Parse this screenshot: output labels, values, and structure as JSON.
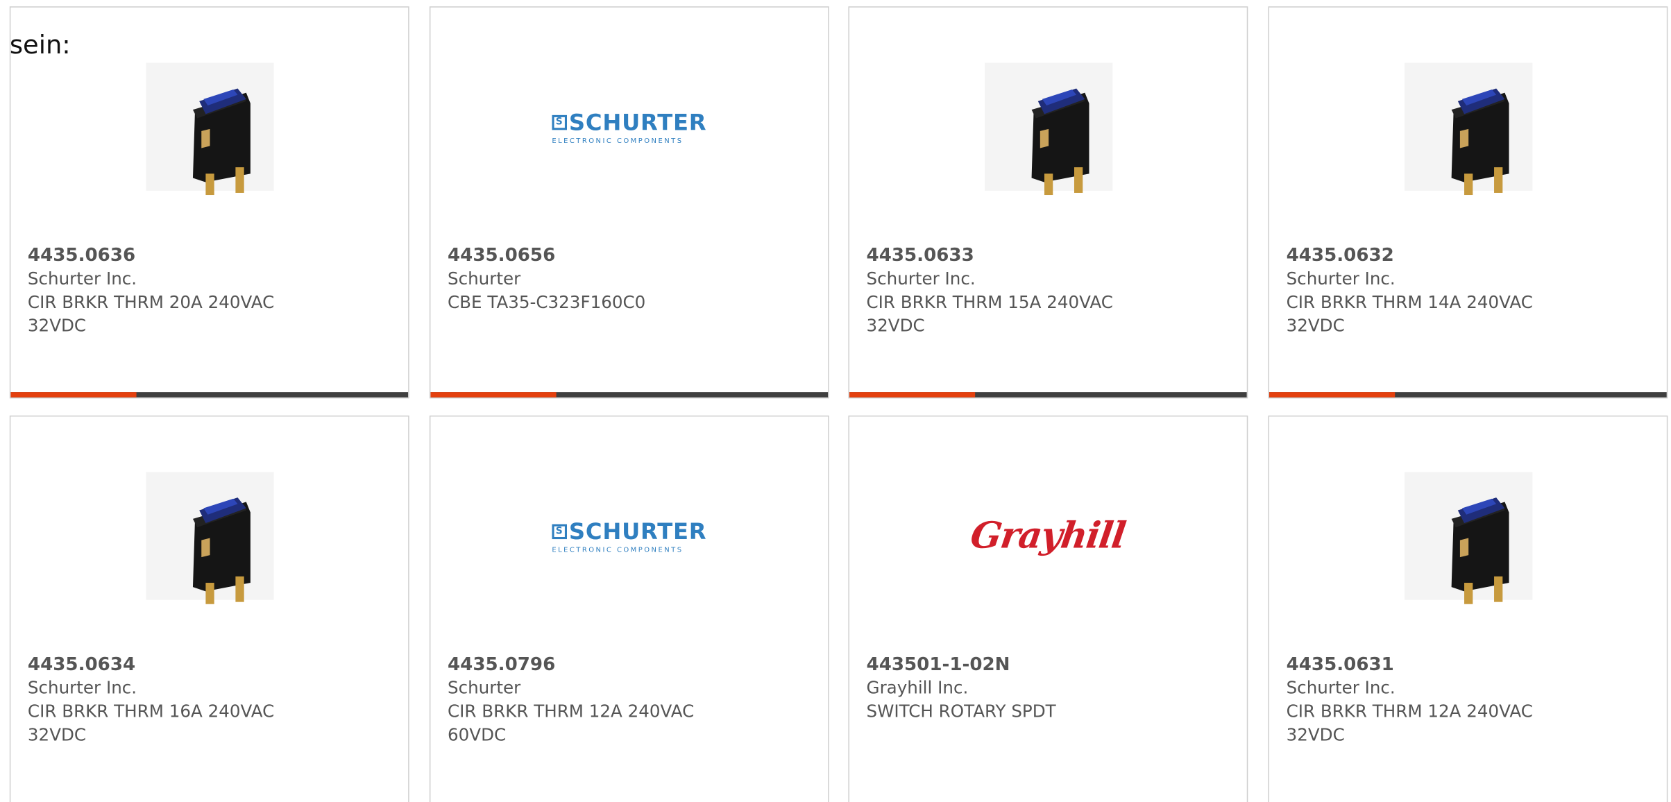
{
  "page": {
    "prefix_text": "sein:"
  },
  "colors": {
    "accent": "#e4400e",
    "bar": "#3f3f3f",
    "text": "#555555",
    "schurter_blue": "#2f7fc0",
    "grayhill_red": "#d11f2a"
  },
  "products": [
    {
      "part_number": "4435.0636",
      "manufacturer": "Schurter Inc.",
      "description": "CIR BRKR THRM 20A 240VAC 32VDC",
      "image": "rocker-switch-icon"
    },
    {
      "part_number": "4435.0656",
      "manufacturer": "Schurter",
      "description": "CBE TA35-C323F160C0",
      "image": "schurter-logo",
      "logo_text": "SCHURTER",
      "logo_sub": "ELECTRONIC COMPONENTS"
    },
    {
      "part_number": "4435.0633",
      "manufacturer": "Schurter Inc.",
      "description": "CIR BRKR THRM 15A 240VAC 32VDC",
      "image": "rocker-switch-icon"
    },
    {
      "part_number": "4435.0632",
      "manufacturer": "Schurter Inc.",
      "description": "CIR BRKR THRM 14A 240VAC 32VDC",
      "image": "rocker-switch-icon"
    },
    {
      "part_number": "4435.0634",
      "manufacturer": "Schurter Inc.",
      "description": "CIR BRKR THRM 16A 240VAC 32VDC",
      "image": "rocker-switch-icon"
    },
    {
      "part_number": "4435.0796",
      "manufacturer": "Schurter",
      "description": "CIR BRKR THRM 12A 240VAC 60VDC",
      "image": "schurter-logo",
      "logo_text": "SCHURTER",
      "logo_sub": "ELECTRONIC COMPONENTS"
    },
    {
      "part_number": "443501-1-02N",
      "manufacturer": "Grayhill Inc.",
      "description": "SWITCH ROTARY SPDT",
      "image": "grayhill-logo",
      "logo_text": "Grayhill"
    },
    {
      "part_number": "4435.0631",
      "manufacturer": "Schurter Inc.",
      "description": "CIR BRKR THRM 12A 240VAC 32VDC",
      "image": "rocker-switch-icon"
    }
  ]
}
